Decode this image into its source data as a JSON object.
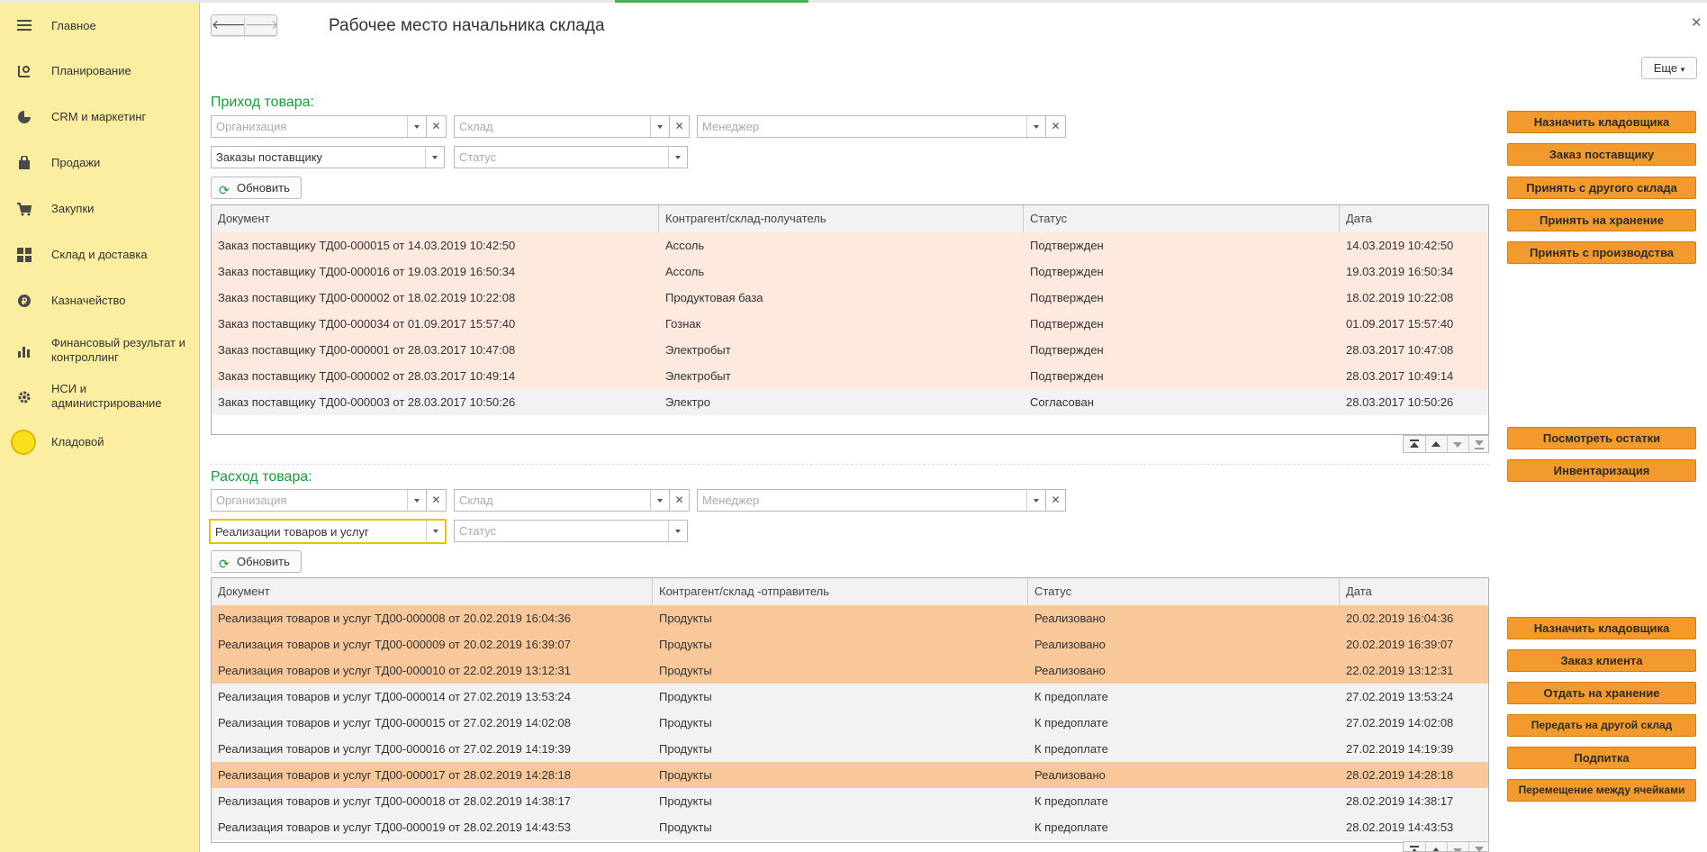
{
  "colors": {
    "sidebar_bg": "#fbeea0",
    "accent_green": "#1a9a3a",
    "action_orange": "#f39a2e",
    "row_peach": "#fde9dd",
    "row_orange": "#f8c79a",
    "row_gray": "#f2f2f2"
  },
  "sidebar": {
    "items": [
      {
        "label": "Главное",
        "icon": "menu-icon"
      },
      {
        "label": "Планирование",
        "icon": "planning-icon"
      },
      {
        "label": "CRM и маркетинг",
        "icon": "pie-chart-icon"
      },
      {
        "label": "Продажи",
        "icon": "shopping-bag-icon"
      },
      {
        "label": "Закупки",
        "icon": "cart-icon"
      },
      {
        "label": "Склад и доставка",
        "icon": "grid-icon"
      },
      {
        "label": "Казначейство",
        "icon": "coin-icon"
      },
      {
        "label": "Финансовый результат и контроллинг",
        "icon": "bar-chart-icon"
      },
      {
        "label": "НСИ и администрирование",
        "icon": "gear-icon"
      },
      {
        "label": "Кладовой",
        "icon": "user-circle-icon"
      }
    ]
  },
  "header": {
    "title": "Рабочее место начальника склада",
    "more_label": "Еще",
    "back_icon": "arrow-left-icon",
    "forward_icon": "arrow-right-icon",
    "close_icon": "close-icon"
  },
  "incoming": {
    "title": "Приход товара:",
    "filters": {
      "org_placeholder": "Организация",
      "warehouse_placeholder": "Склад",
      "manager_placeholder": "Менеджер",
      "doc_type_value": "Заказы поставщику",
      "status_placeholder": "Статус"
    },
    "refresh_label": "Обновить",
    "columns": [
      "Документ",
      "Контрагент/склад-получатель",
      "Статус",
      "Дата"
    ],
    "rows": [
      {
        "doc": "Заказ поставщику ТД00-000015 от 14.03.2019 10:42:50",
        "party": "Ассоль",
        "status": "Подтвержден",
        "date": "14.03.2019 10:42:50",
        "tone": "peach"
      },
      {
        "doc": "Заказ поставщику ТД00-000016 от 19.03.2019 16:50:34",
        "party": "Ассоль",
        "status": "Подтвержден",
        "date": "19.03.2019 16:50:34",
        "tone": "peach"
      },
      {
        "doc": "Заказ поставщику ТД00-000002 от 18.02.2019 10:22:08",
        "party": "Продуктовая база",
        "status": "Подтвержден",
        "date": "18.02.2019 10:22:08",
        "tone": "peach"
      },
      {
        "doc": "Заказ поставщику ТД00-000034 от 01.09.2017 15:57:40",
        "party": "Гознак",
        "status": "Подтвержден",
        "date": "01.09.2017 15:57:40",
        "tone": "peach"
      },
      {
        "doc": "Заказ поставщику ТД00-000001 от 28.03.2017 10:47:08",
        "party": "Электробыт",
        "status": "Подтвержден",
        "date": "28.03.2017 10:47:08",
        "tone": "peach"
      },
      {
        "doc": "Заказ поставщику ТД00-000002 от 28.03.2017 10:49:14",
        "party": "Электробыт",
        "status": "Подтвержден",
        "date": "28.03.2017 10:49:14",
        "tone": "peach"
      },
      {
        "doc": "Заказ поставщику ТД00-000003 от 28.03.2017 10:50:26",
        "party": "Электро",
        "status": "Согласован",
        "date": "28.03.2017 10:50:26",
        "tone": "gray"
      }
    ],
    "actions": [
      "Назначить кладовщика",
      "Заказ поставщику",
      "Принять с другого склада",
      "Принять на хранение",
      "Принять с производства"
    ],
    "stock_actions": [
      "Посмотреть остатки",
      "Инвентаризация"
    ]
  },
  "outgoing": {
    "title": "Расход товара:",
    "filters": {
      "org_placeholder": "Организация",
      "warehouse_placeholder": "Склад",
      "manager_placeholder": "Менеджер",
      "doc_type_value": "Реализации товаров и услуг",
      "status_placeholder": "Статус"
    },
    "refresh_label": "Обновить",
    "columns": [
      "Документ",
      "Контрагент/склад -отправитель",
      "Статус",
      "Дата"
    ],
    "rows": [
      {
        "doc": "Реализация товаров и услуг ТД00-000008 от 20.02.2019 16:04:36",
        "party": "Продукты",
        "status": "Реализовано",
        "date": "20.02.2019 16:04:36",
        "tone": "orange"
      },
      {
        "doc": "Реализация товаров и услуг ТД00-000009 от 20.02.2019 16:39:07",
        "party": "Продукты",
        "status": "Реализовано",
        "date": "20.02.2019 16:39:07",
        "tone": "orange"
      },
      {
        "doc": "Реализация товаров и услуг ТД00-000010 от 22.02.2019 13:12:31",
        "party": "Продукты",
        "status": "Реализовано",
        "date": "22.02.2019 13:12:31",
        "tone": "orange"
      },
      {
        "doc": "Реализация товаров и услуг ТД00-000014 от 27.02.2019 13:53:24",
        "party": "Продукты",
        "status": "К предоплате",
        "date": "27.02.2019 13:53:24",
        "tone": "gray"
      },
      {
        "doc": "Реализация товаров и услуг ТД00-000015 от 27.02.2019 14:02:08",
        "party": "Продукты",
        "status": "К предоплате",
        "date": "27.02.2019 14:02:08",
        "tone": "gray"
      },
      {
        "doc": "Реализация товаров и услуг ТД00-000016 от 27.02.2019 14:19:39",
        "party": "Продукты",
        "status": "К предоплате",
        "date": "27.02.2019 14:19:39",
        "tone": "gray"
      },
      {
        "doc": "Реализация товаров и услуг ТД00-000017 от 28.02.2019 14:28:18",
        "party": "Продукты",
        "status": "Реализовано",
        "date": "28.02.2019 14:28:18",
        "tone": "orange"
      },
      {
        "doc": "Реализация товаров и услуг ТД00-000018 от 28.02.2019 14:38:17",
        "party": "Продукты",
        "status": "К предоплате",
        "date": "28.02.2019 14:38:17",
        "tone": "gray"
      },
      {
        "doc": "Реализация товаров и услуг ТД00-000019 от 28.02.2019 14:43:53",
        "party": "Продукты",
        "status": "К предоплате",
        "date": "28.02.2019 14:43:53",
        "tone": "gray"
      }
    ],
    "actions": [
      "Назначить кладовщика",
      "Заказ клиента",
      "Отдать на хранение",
      "Передать на другой склад",
      "Подпитка",
      "Перемещение между ячейками"
    ]
  }
}
